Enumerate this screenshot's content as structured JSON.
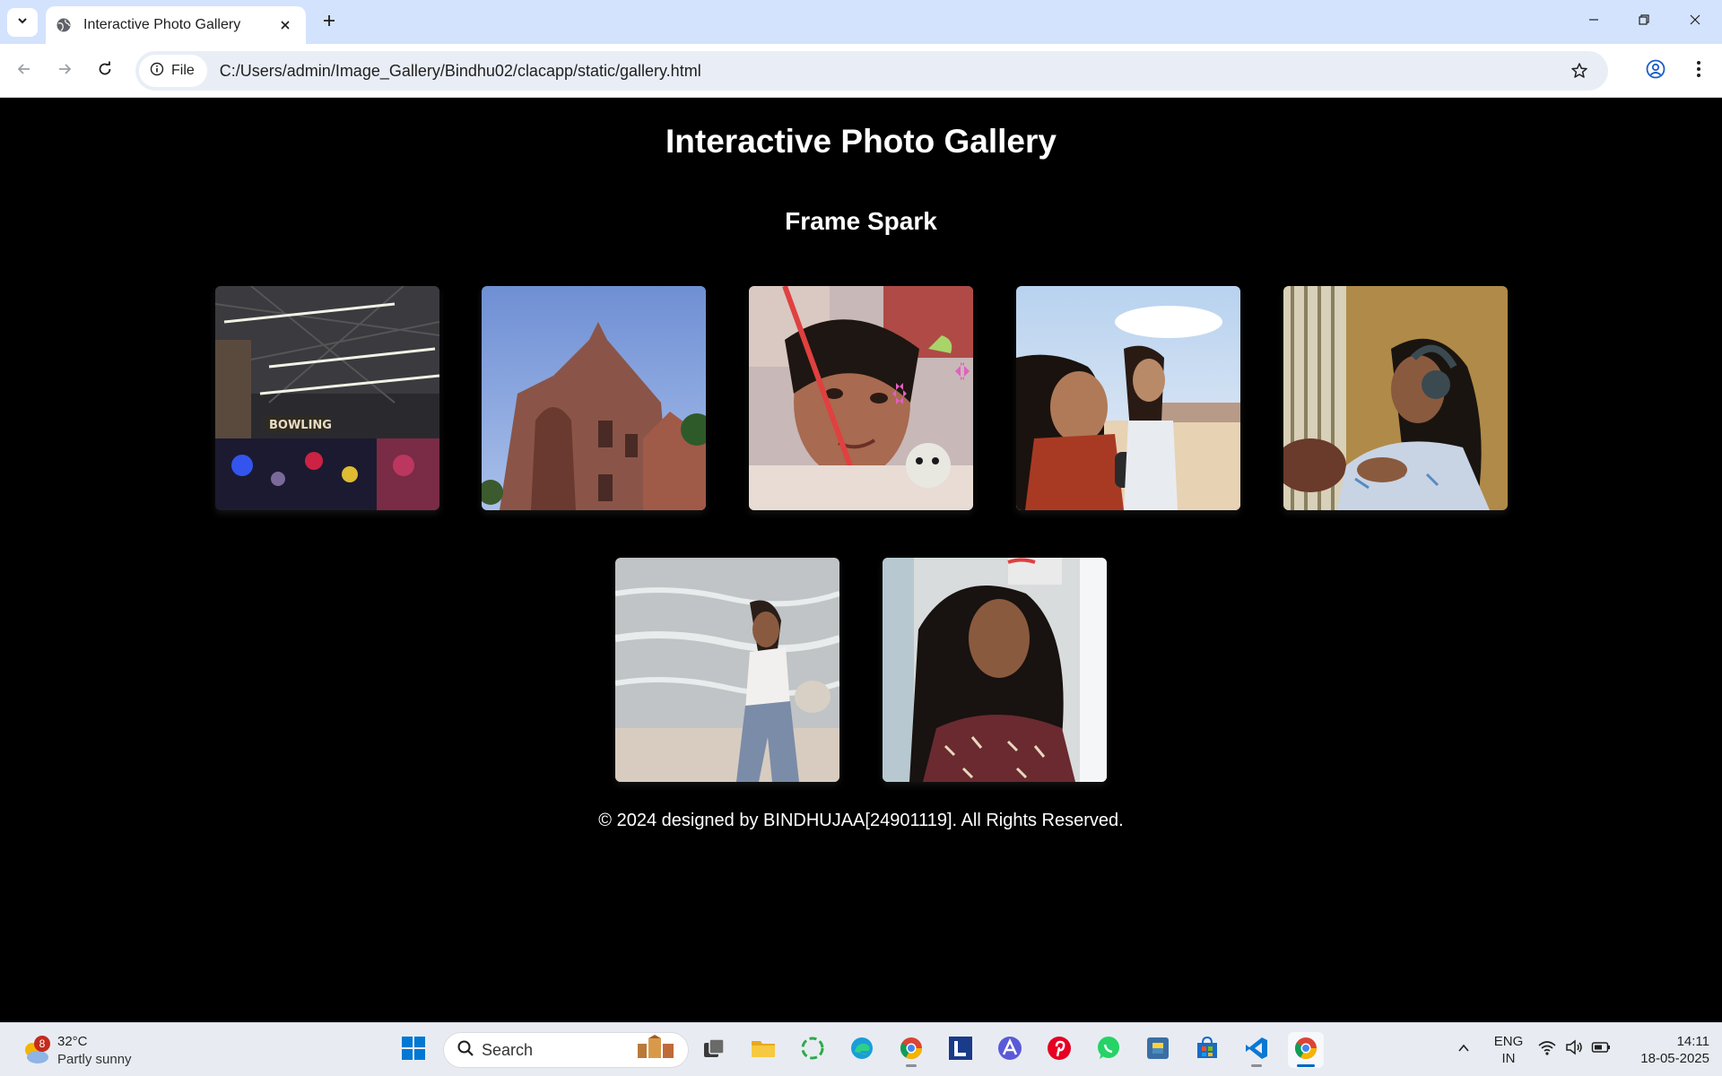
{
  "browser": {
    "tab_title": "Interactive Photo Gallery",
    "site_chip_label": "File",
    "url": "C:/Users/admin/Image_Gallery/Bindhu02/clacapp/static/gallery.html"
  },
  "page": {
    "title": "Interactive Photo Gallery",
    "subtitle": "Frame Spark",
    "photos": [
      {
        "name": "bowling-arcade-photo",
        "sign_text": "BOWLING"
      },
      {
        "name": "palace-building-photo"
      },
      {
        "name": "selfie-with-butterflies-photo"
      },
      {
        "name": "beach-friends-photo"
      },
      {
        "name": "girl-with-headphones-photo"
      },
      {
        "name": "girl-on-beach-photo"
      },
      {
        "name": "girl-portrait-photo"
      }
    ],
    "footer": "© 2024 designed by BINDHUJAA[24901119]. All Rights Reserved."
  },
  "taskbar": {
    "weather_badge": "8",
    "weather_temp": "32°C",
    "weather_desc": "Partly sunny",
    "search_label": "Search",
    "lang_line1": "ENG",
    "lang_line2": "IN",
    "time": "14:11",
    "date": "18-05-2025",
    "apps": [
      "windows-start-icon",
      "task-view-icon",
      "file-explorer-icon",
      "circular-app-icon",
      "edge-icon",
      "chrome-icon",
      "l-app-icon",
      "arc-app-icon",
      "pinterest-icon",
      "whatsapp-icon",
      "python-icon",
      "store-icon",
      "vscode-icon",
      "chrome-active-icon"
    ]
  },
  "colors": {
    "tabbar_bg": "#d3e3fd",
    "page_bg": "#000000",
    "page_text": "#ffffff",
    "accent": "#0067c0"
  }
}
